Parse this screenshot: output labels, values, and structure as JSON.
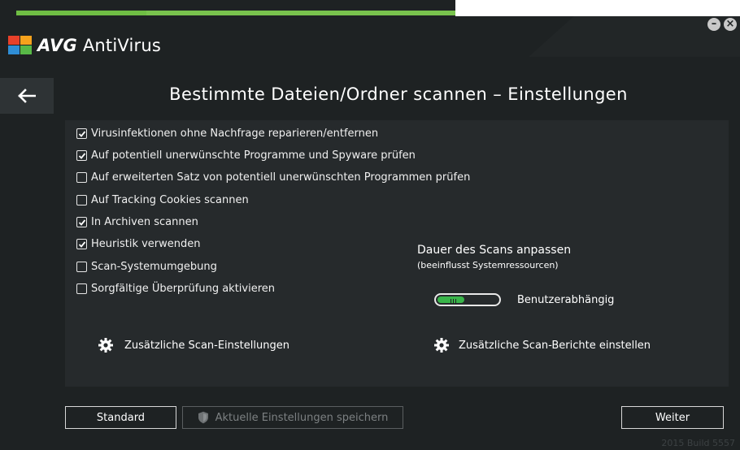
{
  "app": {
    "brand": "AVG",
    "product": "AntiVirus"
  },
  "window_controls": {
    "minimize": "–",
    "close": "×"
  },
  "page_title": "Bestimmte Dateien/Ordner scannen – Einstellungen",
  "options": [
    {
      "label": "Virusinfektionen ohne Nachfrage reparieren/entfernen",
      "checked": true
    },
    {
      "label": "Auf potentiell unerwünschte Programme und Spyware prüfen",
      "checked": true
    },
    {
      "label": "Auf erweiterten Satz von potentiell unerwünschten Programmen prüfen",
      "checked": false
    },
    {
      "label": "Auf Tracking Cookies scannen",
      "checked": false
    },
    {
      "label": "In Archiven scannen",
      "checked": true
    },
    {
      "label": "Heuristik verwenden",
      "checked": true
    },
    {
      "label": "Scan-Systemumgebung",
      "checked": false
    },
    {
      "label": "Sorgfältige Überprüfung aktivieren",
      "checked": false
    }
  ],
  "scan_duration": {
    "title": "Dauer des Scans anpassen",
    "subtitle": "(beeinflusst Systemressourcen)",
    "value_label": "Benutzerabhängig",
    "level": 0.45,
    "accent": "#39b54a"
  },
  "links": {
    "additional_settings": "Zusätzliche Scan-Einstellungen",
    "additional_reports": "Zusätzliche Scan-Berichte einstellen"
  },
  "buttons": {
    "standard": "Standard",
    "save_current": "Aktuelle Einstellungen speichern",
    "next": "Weiter"
  },
  "build": "2015  Build 5557",
  "colors": {
    "background": "#1e2223",
    "panel": "#262a2c",
    "brand_green": "#6fbe44"
  }
}
